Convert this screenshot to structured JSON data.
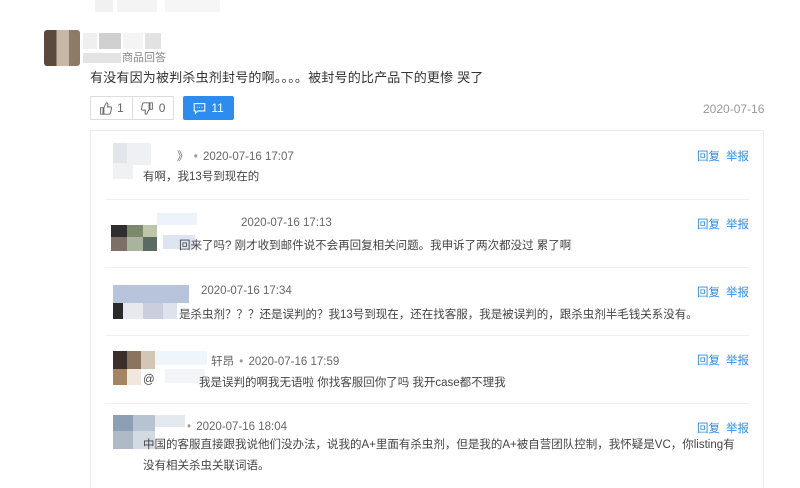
{
  "post": {
    "source": "商品回答",
    "text": "有没有因为被判杀虫剂封号的啊。。。。被封号的比产品下的更惨 哭了",
    "likes": "1",
    "dislikes": "0",
    "comments": "11",
    "date": "2020-07-16"
  },
  "replies": [
    {
      "name_suffix": "》",
      "time": "2020-07-16 17:07",
      "text": "有啊，我13号到现在的"
    },
    {
      "name_suffix": "",
      "time": "2020-07-16 17:13",
      "text": "回来了吗? 刚才收到邮件说不会再回复相关问题。我申诉了两次都没过 累了啊"
    },
    {
      "name_suffix": "",
      "time": "2020-07-16 17:34",
      "text": "是杀虫剂？？？还是误判的？我13号到现在，还在找客服，我是被误判的，跟杀虫剂半毛钱关系没有。"
    },
    {
      "name_suffix": "轩昂",
      "time": "2020-07-16 17:59",
      "text": "我是误判的啊我无语啦 你找客服回你了吗 我开case都不理我",
      "mention": "@"
    },
    {
      "name_suffix": "",
      "time": "2020-07-16 18:04",
      "text": "中国的客服直接跟我说他们没办法，说我的A+里面有杀虫剂，但是我的A+被自营团队控制，我怀疑是VC，你listing有没有相关杀虫关联词语。"
    }
  ],
  "actions": {
    "reply": "回复",
    "report": "举报"
  },
  "dot": "•",
  "colors": {
    "accent": "#2d8cf0",
    "text": "#333333",
    "muted": "#999999"
  }
}
